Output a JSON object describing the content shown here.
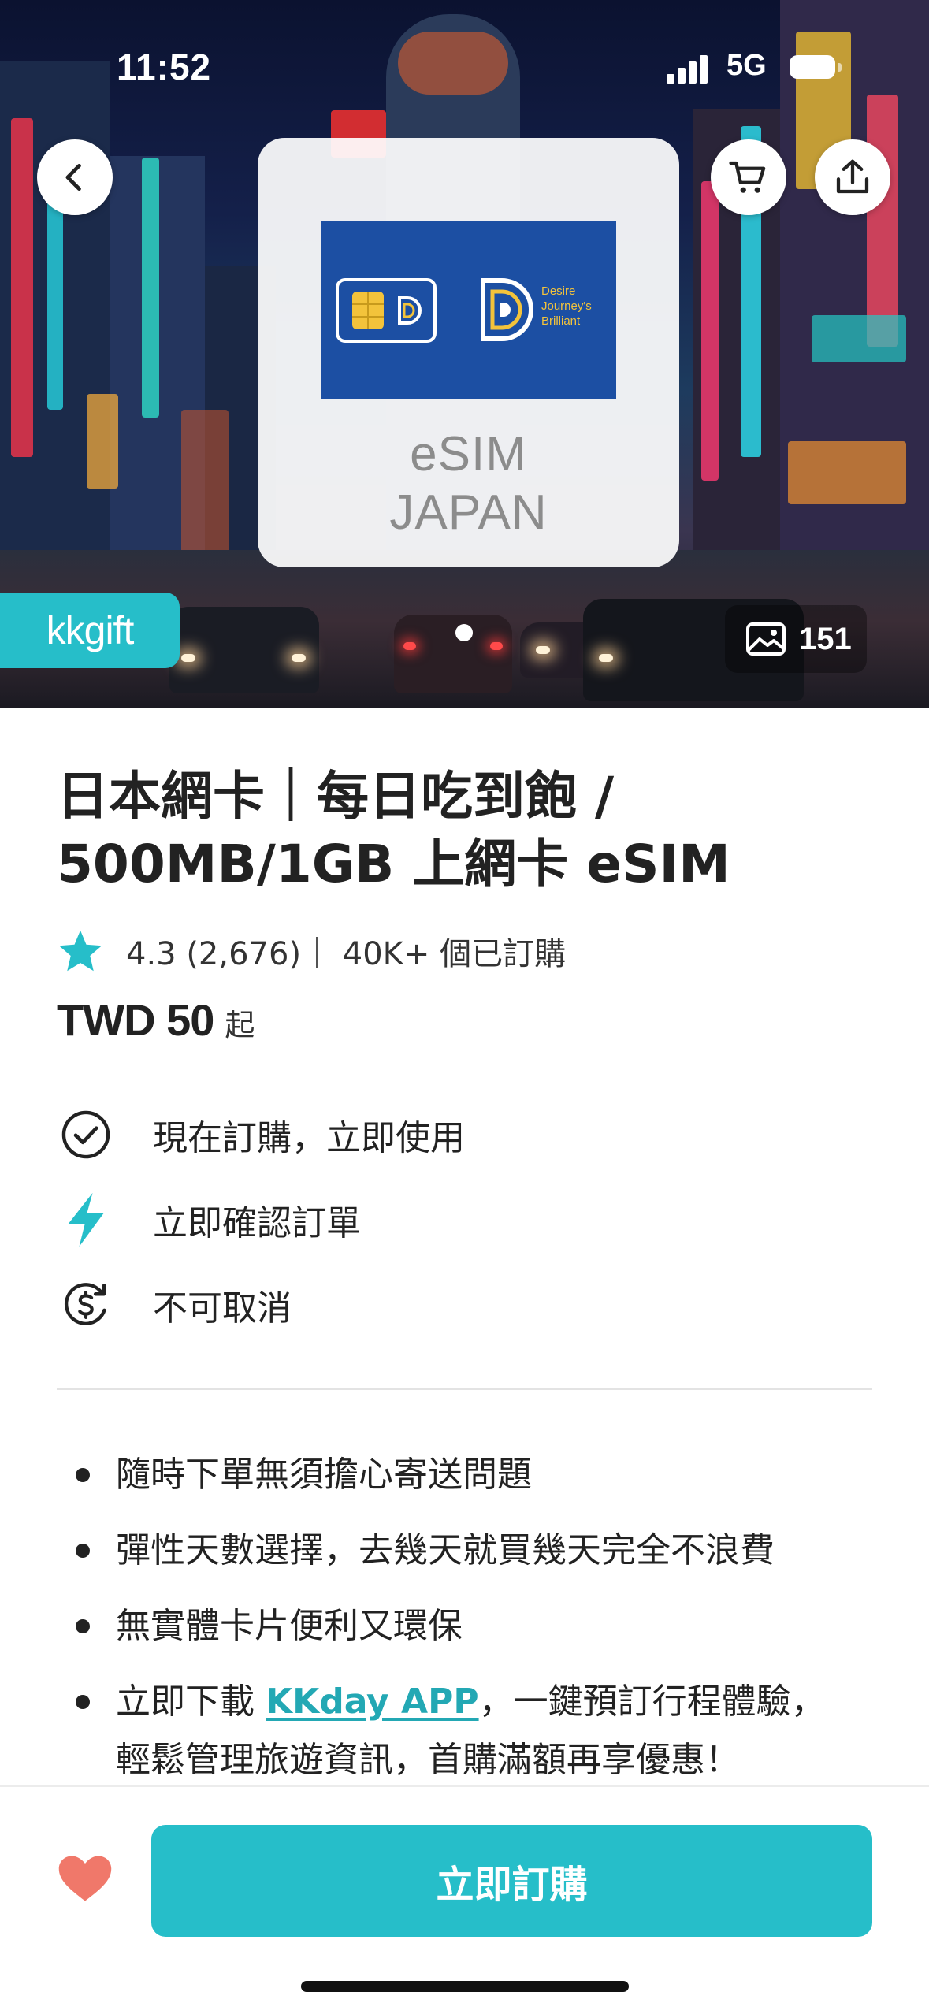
{
  "status_bar": {
    "time": "11:52",
    "network": "5G"
  },
  "hero": {
    "esim_card": {
      "brand_line1": "Desire",
      "brand_line2": "Journey's",
      "brand_line3": "Brilliant",
      "line1": "eSIM",
      "line2": "JAPAN"
    },
    "tag": "kkgift",
    "photo_count": "151",
    "icons": {
      "back": "chevron-left-icon",
      "cart": "cart-icon",
      "share": "share-icon",
      "photos": "image-icon"
    }
  },
  "product": {
    "title_line1": "日本網卡｜每日吃到飽 /",
    "title_line2": "500MB/1GB 上網卡 eSIM",
    "rating_text": "4.3 (2,676)｜ 40K+ 個已訂購",
    "price": "TWD 50",
    "price_suffix": "起"
  },
  "features": [
    {
      "label": "現在訂購，立即使用",
      "icon": "check-circle-icon"
    },
    {
      "label": "立即確認訂單",
      "icon": "lightning-icon"
    },
    {
      "label": "不可取消",
      "icon": "dollar-refund-icon"
    }
  ],
  "bullets": {
    "item1": "隨時下單無須擔心寄送問題",
    "item2": "彈性天數選擇，去幾天就買幾天完全不浪費",
    "item3": "無實體卡片便利又環保",
    "item4_prefix": "立即下載 ",
    "item4_link": "KKday APP",
    "item4_suffix": "，一鍵預訂行程體驗，",
    "item4_line2": "輕鬆管理旅遊資訊，首購滿額再享優惠！"
  },
  "bottom_bar": {
    "cta_label": "立即訂購"
  },
  "colors": {
    "accent": "#26bec9",
    "link": "#23a8b4",
    "heart": "#f0786a",
    "esim_blue": "#1c4fa3"
  }
}
